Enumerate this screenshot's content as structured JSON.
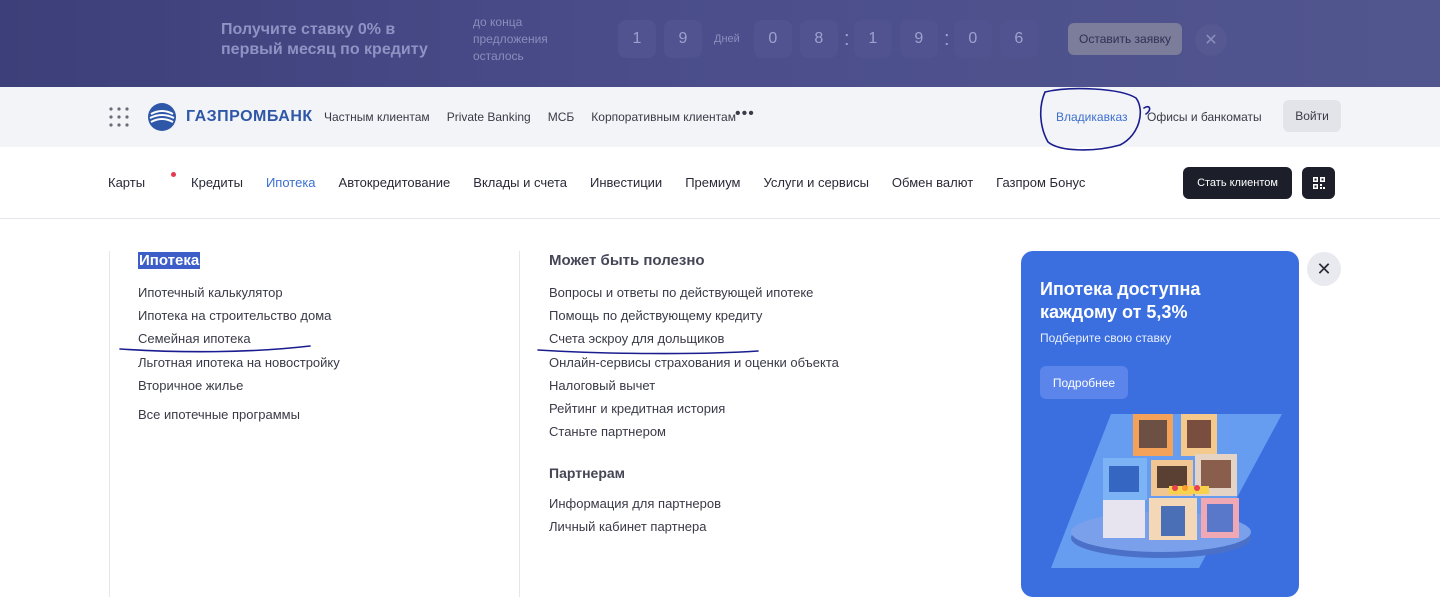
{
  "promo": {
    "title": "Получите ставку 0% в первый месяц по кредиту",
    "subtitle": "до конца предложения осталось",
    "days_digits": [
      "1",
      "9"
    ],
    "days_label": "Дней",
    "time_digits": [
      "0",
      "8",
      "1",
      "9",
      "0",
      "6"
    ],
    "apply_label": "Оставить заявку",
    "close_icon": "close-icon"
  },
  "topbar": {
    "logo_text": "ГАЗПРОМБАНК",
    "segments": [
      "Частным клиентам",
      "Private Banking",
      "МСБ",
      "Корпоративным клиентам"
    ],
    "more": "•••",
    "city": "Владикавказ",
    "offices": "Офисы и банкоматы",
    "login": "Войти"
  },
  "mainnav": {
    "items": [
      "Карты",
      "Кредиты",
      "Ипотека",
      "Автокредитование",
      "Вклады и счета",
      "Инвестиции",
      "Премиум",
      "Услуги и сервисы",
      "Обмен валют",
      "Газпром Бонус"
    ],
    "active": "Ипотека",
    "become_client": "Стать клиентом"
  },
  "menu": {
    "col1": {
      "title": "Ипотека",
      "links": [
        "Ипотечный калькулятор",
        "Ипотека на строительство дома",
        "Семейная ипотека",
        "Льготная ипотека на новостройку",
        "Вторичное жилье"
      ],
      "all": "Все ипотечные программы"
    },
    "col2": {
      "title": "Может быть полезно",
      "links": [
        "Вопросы и ответы по действующей ипотеке",
        "Помощь по действующему кредиту",
        "Счета эскроу для дольщиков",
        "Онлайн-сервисы страхования и оценки объекта",
        "Налоговый вычет",
        "Рейтинг и кредитная история",
        "Станьте партнером"
      ],
      "partners_title": "Партнерам",
      "partners_links": [
        "Информация для партнеров",
        "Личный кабинет партнера"
      ]
    },
    "banner": {
      "title": "Ипотека доступна каждому от 5,3%",
      "subtitle": "Подберите свою ставку",
      "button": "Подробнее"
    }
  },
  "colors": {
    "promo_bg": "#434685",
    "accent": "#3c6fd0",
    "banner_bg": "#3b6fe0",
    "dark_button": "#1c1f2a",
    "annotation_ink": "#1a1d8f"
  }
}
